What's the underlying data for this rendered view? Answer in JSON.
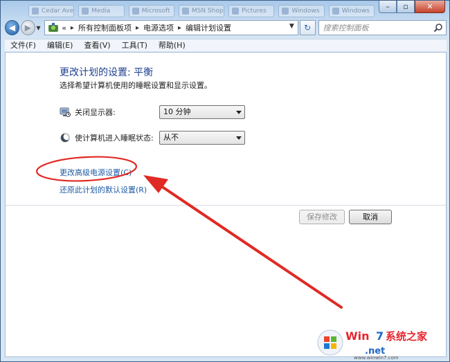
{
  "titlebar": {
    "ghost_tabs": [
      "Cedar Ave",
      "Media",
      "Microsoft",
      "MSN Shop",
      "Pictures",
      "Windows",
      "Windows"
    ]
  },
  "nav": {
    "breadcrumb_prefix": "«",
    "crumbs": [
      "所有控制面板项",
      "电源选项",
      "编辑计划设置"
    ],
    "search_placeholder": "搜索控制面板"
  },
  "menu": [
    "文件(F)",
    "编辑(E)",
    "查看(V)",
    "工具(T)",
    "帮助(H)"
  ],
  "content": {
    "title": "更改计划的设置: 平衡",
    "subtitle": "选择希望计算机使用的睡眠设置和显示设置。",
    "settings": [
      {
        "label": "关闭显示器:",
        "value": "10 分钟",
        "icon": "monitor-icon"
      },
      {
        "label": "使计算机进入睡眠状态:",
        "value": "从不",
        "icon": "moon-icon"
      }
    ],
    "links": {
      "advanced": "更改高级电源设置(C)",
      "restore": "还原此计划的默认设置(R)"
    },
    "buttons": {
      "save": "保存修改",
      "cancel": "取消"
    }
  },
  "watermark": {
    "text_cn": "系统之家",
    "text_site": "Win7.net",
    "url": "www.winwin7.com"
  },
  "colors": {
    "title_blue": "#1e3f8f",
    "link_blue": "#1e5aa6",
    "annotation_red": "#e02a24"
  }
}
